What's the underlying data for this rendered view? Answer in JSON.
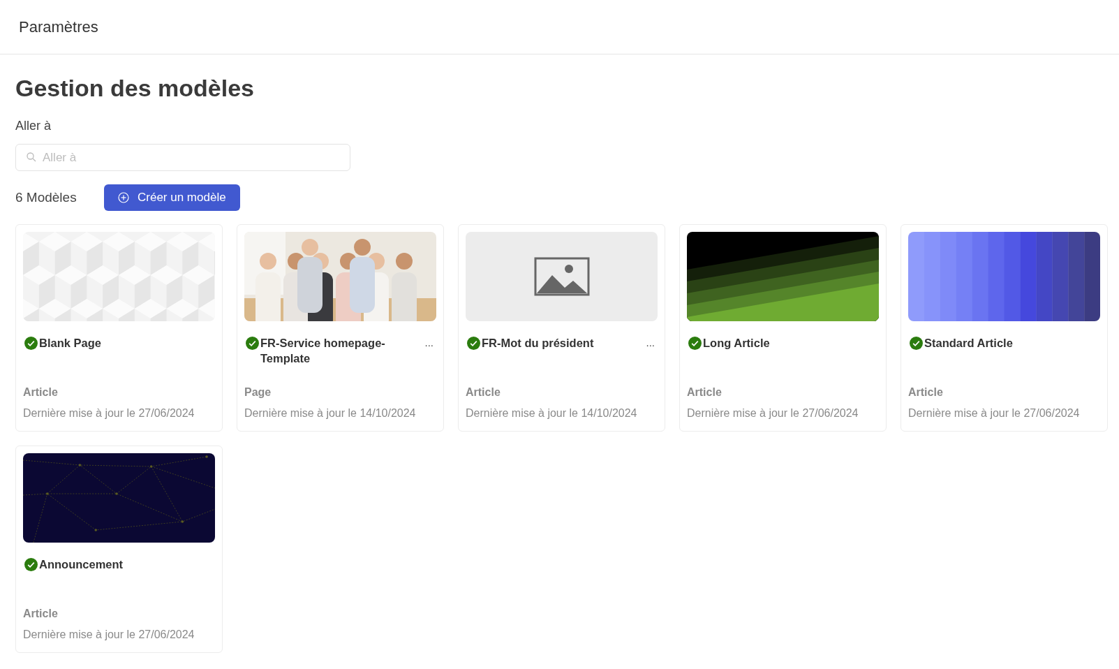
{
  "header": {
    "title": "Paramètres"
  },
  "page_title": "Gestion des modèles",
  "search": {
    "label": "Aller à",
    "placeholder": "Aller à"
  },
  "count": "6 Modèles",
  "create_button": "Créer un modèle",
  "templates": [
    {
      "name": "Blank Page",
      "published": true,
      "thumbnail": {
        "kind": "hexagons"
      },
      "type": "Article",
      "updated": "Dernière mise à jour le 27/06/2024"
    },
    {
      "name": "FR-Service homepage-Template",
      "published": true,
      "menu": "...",
      "type": "Page",
      "updated": "Dernière mise à jour le 14/10/2024"
    },
    {
      "name": "FR-Mot du président",
      "published": true,
      "thumbnail": {
        "kind": "placeholder"
      },
      "menu": "...",
      "type": "Article",
      "updated": "Dernière mise à jour le 14/10/2024"
    },
    {
      "name": "Long Article",
      "published": true,
      "thumbnail": {
        "kind": "stripes"
      },
      "type": "Article",
      "updated": "Dernière mise à jour le 27/06/2024"
    },
    {
      "name": "Standard Article",
      "published": true,
      "thumbnail": {
        "kind": "gradient"
      },
      "type": "Article",
      "updated": "Dernière mise à jour le 27/06/2024"
    },
    {
      "name": "Announcement",
      "published": true,
      "thumbnail": {
        "kind": "network"
      },
      "type": "Article",
      "updated": "Dernière mise à jour le 27/06/2024"
    }
  ]
}
